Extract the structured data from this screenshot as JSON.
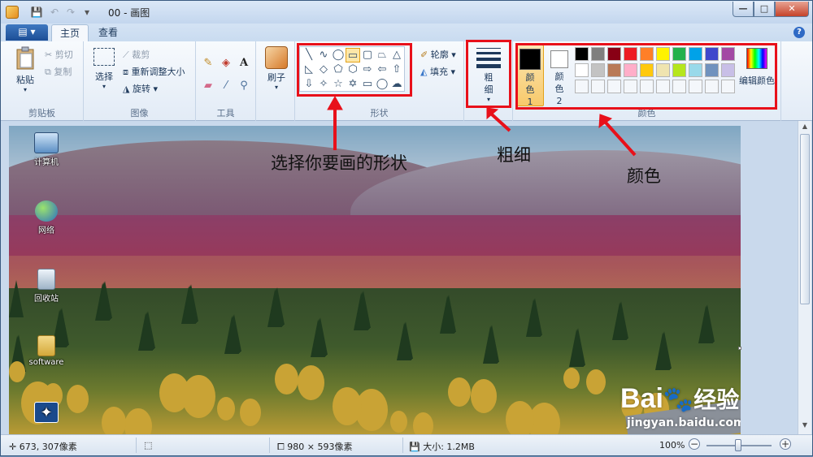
{
  "window": {
    "title": "00 - 画图",
    "controls": {
      "minimize": "—",
      "maximize": "□",
      "close": "✕"
    }
  },
  "tabs": {
    "file_menu": "▤ ▾",
    "home": "主页",
    "view": "查看",
    "help": "?"
  },
  "ribbon": {
    "clipboard": {
      "label": "剪贴板",
      "paste": "粘贴",
      "cut": "剪切",
      "copy": "复制"
    },
    "image": {
      "label": "图像",
      "select": "选择",
      "crop": "裁剪",
      "resize": "重新调整大小",
      "rotate": "旋转"
    },
    "tools": {
      "label": "工具"
    },
    "brushes": {
      "label": "刷子"
    },
    "shapes": {
      "label": "形状",
      "outline": "轮廓",
      "fill": "填充"
    },
    "size": {
      "label": "粗细"
    },
    "colors": {
      "label": "颜色",
      "color1": "颜色 1",
      "color2": "颜色 2",
      "edit": "编辑颜色",
      "color1_value": "#000000",
      "color2_value": "#ffffff",
      "palette_row1": [
        "#000000",
        "#7f7f7f",
        "#880015",
        "#ed1c24",
        "#ff7f27",
        "#fff200",
        "#22b14c",
        "#00a2e8",
        "#3f48cc",
        "#a349a4"
      ],
      "palette_row2": [
        "#ffffff",
        "#c3c3c3",
        "#b97a57",
        "#ffaec9",
        "#ffc90e",
        "#efe4b0",
        "#b5e61d",
        "#99d9ea",
        "#7092be",
        "#c8bfe7"
      ],
      "palette_row3": [
        "#f4f7fb",
        "#f4f7fb",
        "#f4f7fb",
        "#f4f7fb",
        "#f4f7fb",
        "#f4f7fb",
        "#f4f7fb",
        "#f4f7fb",
        "#f4f7fb",
        "#f4f7fb"
      ]
    }
  },
  "desktop_icons": [
    {
      "label": "计算机"
    },
    {
      "label": "网络"
    },
    {
      "label": "回收站"
    },
    {
      "label": "software"
    }
  ],
  "annotations": {
    "shapes": "选择你要画的形状",
    "size": "粗细",
    "colors": "颜色",
    "accent": "#e8101a"
  },
  "statusbar": {
    "cursor": "673, 307像素",
    "image_size": "980 × 593像素",
    "file_size": "大小: 1.2MB",
    "zoom": "100%",
    "zoom_out": "−",
    "zoom_in": "+"
  },
  "watermark": {
    "brand": "Bai",
    "brand2": "经验",
    "url": "jingyan.baidu.com"
  }
}
